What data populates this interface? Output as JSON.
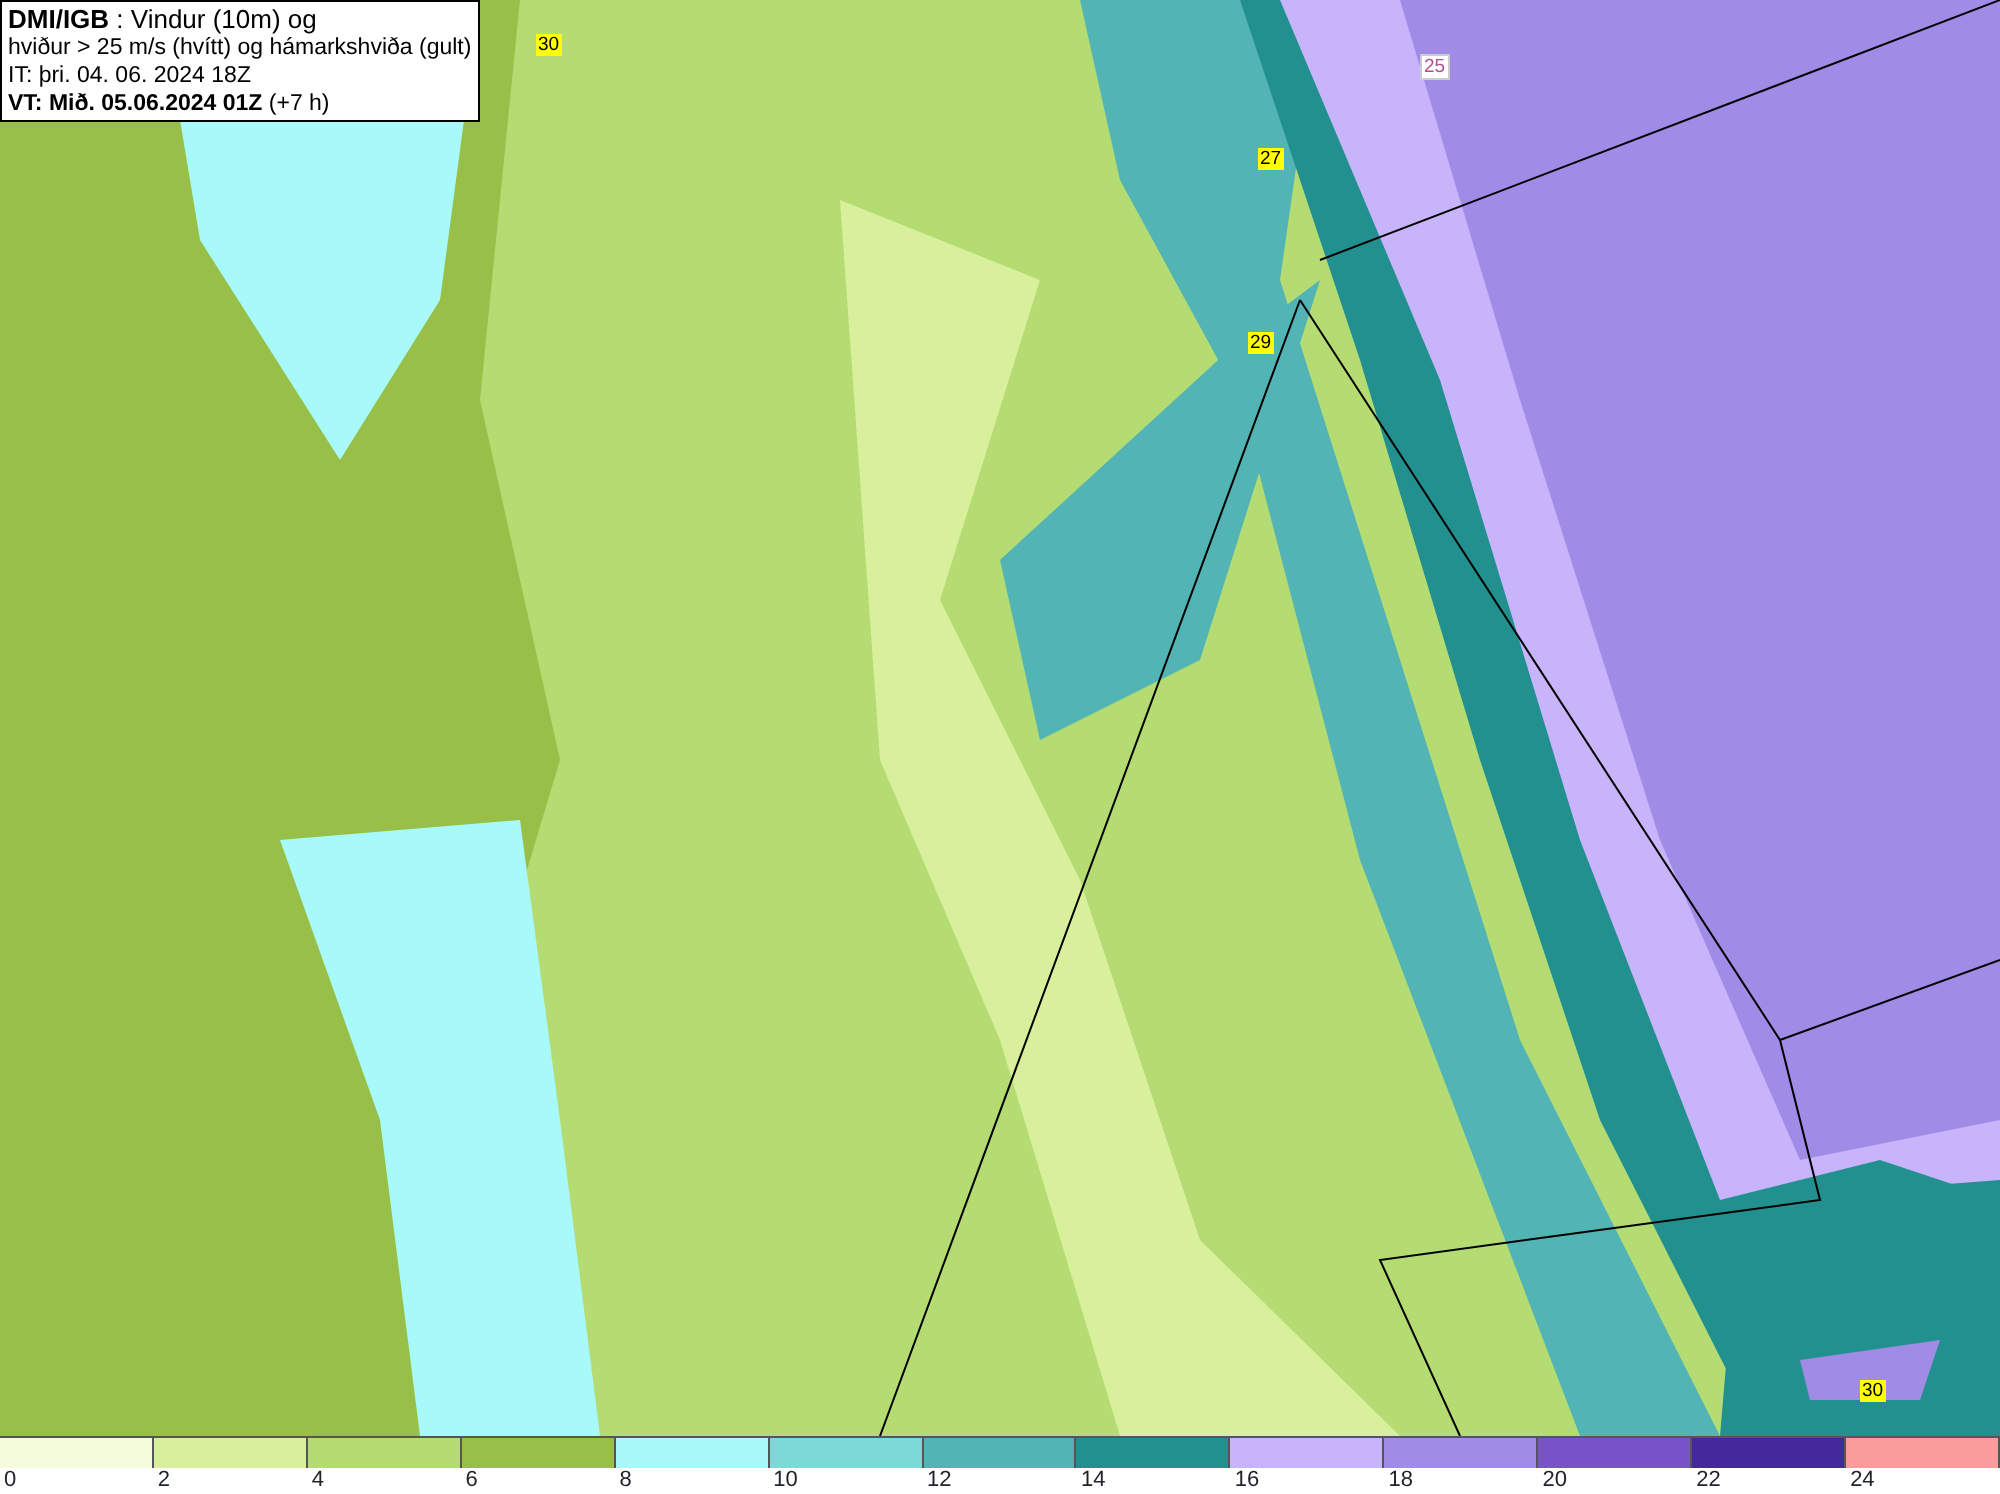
{
  "header": {
    "lines": [
      "**DMI/IGB** : Vindur (10m) og",
      "hviður > 25 m/s (hvítt) og hámarkshviða (gult)",
      "IT: þri. 04. 06. 2024 18Z",
      "**VT: Mið. 05.06.2024 01Z** (+7 h)"
    ]
  },
  "map": {
    "labels": [
      {
        "text": "30",
        "kind": "max"
      },
      {
        "text": "25",
        "kind": "isotach"
      },
      {
        "text": "27",
        "kind": "max"
      },
      {
        "text": "29",
        "kind": "max"
      },
      {
        "text": "30",
        "kind": "max"
      }
    ]
  },
  "legend": {
    "swatches": [
      {
        "color": "#f5fcdc"
      },
      {
        "color": "#d8ef9c"
      },
      {
        "color": "#b4dc72"
      },
      {
        "color": "#98c048"
      },
      {
        "color": "#a8fafa"
      },
      {
        "color": "#7dd8d8"
      },
      {
        "color": "#52b4b4"
      },
      {
        "color": "#239090"
      },
      {
        "color": "#c8b4fa"
      },
      {
        "color": "#a08ce6"
      },
      {
        "color": "#7854c8"
      },
      {
        "color": "#44289c"
      },
      {
        "color": "#fa9c9c"
      }
    ],
    "ticks": [
      "0",
      "2",
      "4",
      "6",
      "8",
      "10",
      "12",
      "14",
      "16",
      "18",
      "20",
      "22",
      "24"
    ]
  }
}
